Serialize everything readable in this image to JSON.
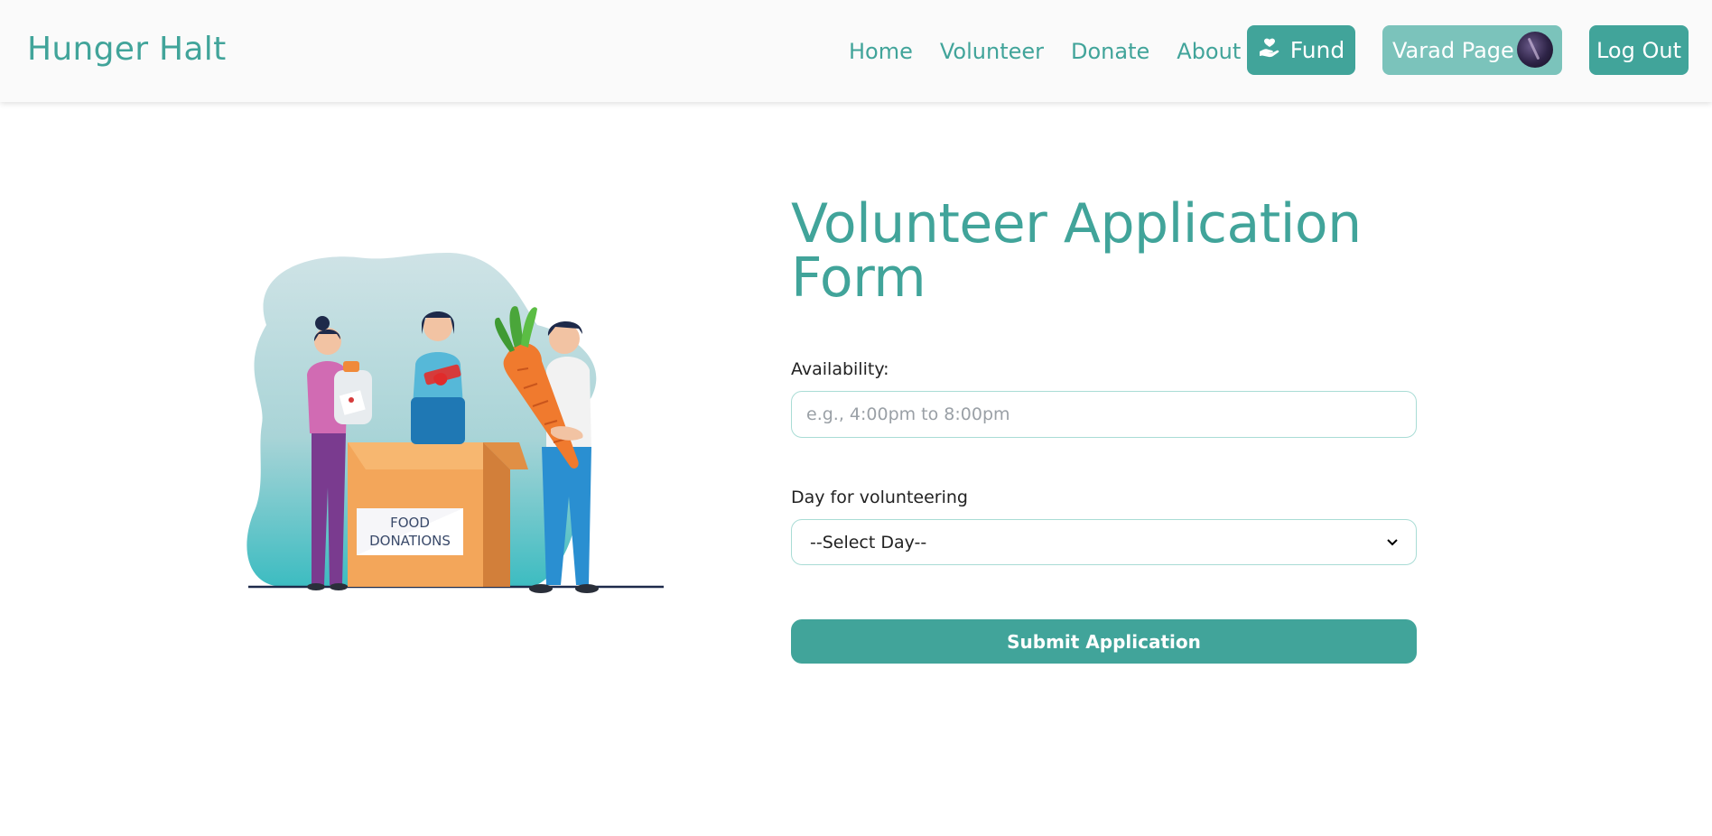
{
  "brand": "Hunger Halt",
  "nav": {
    "links": [
      "Home",
      "Volunteer",
      "Donate",
      "About"
    ],
    "fund_label": "Fund",
    "profile_label": "Varad Page",
    "logout_label": "Log Out"
  },
  "illustration": {
    "box_label_line1": "FOOD",
    "box_label_line2": "DONATIONS"
  },
  "form": {
    "title_line1": "Volunteer Application",
    "title_line2": "Form",
    "availability_label": "Availability:",
    "availability_value": "",
    "availability_placeholder": "e.g., 4:00pm to 8:00pm",
    "day_label": "Day for volunteering",
    "day_selected": "--Select Day--",
    "submit_label": "Submit Application"
  },
  "colors": {
    "accent": "#41a49a",
    "accent_light": "#7bc3bb",
    "field_border": "#a9dcd5"
  }
}
